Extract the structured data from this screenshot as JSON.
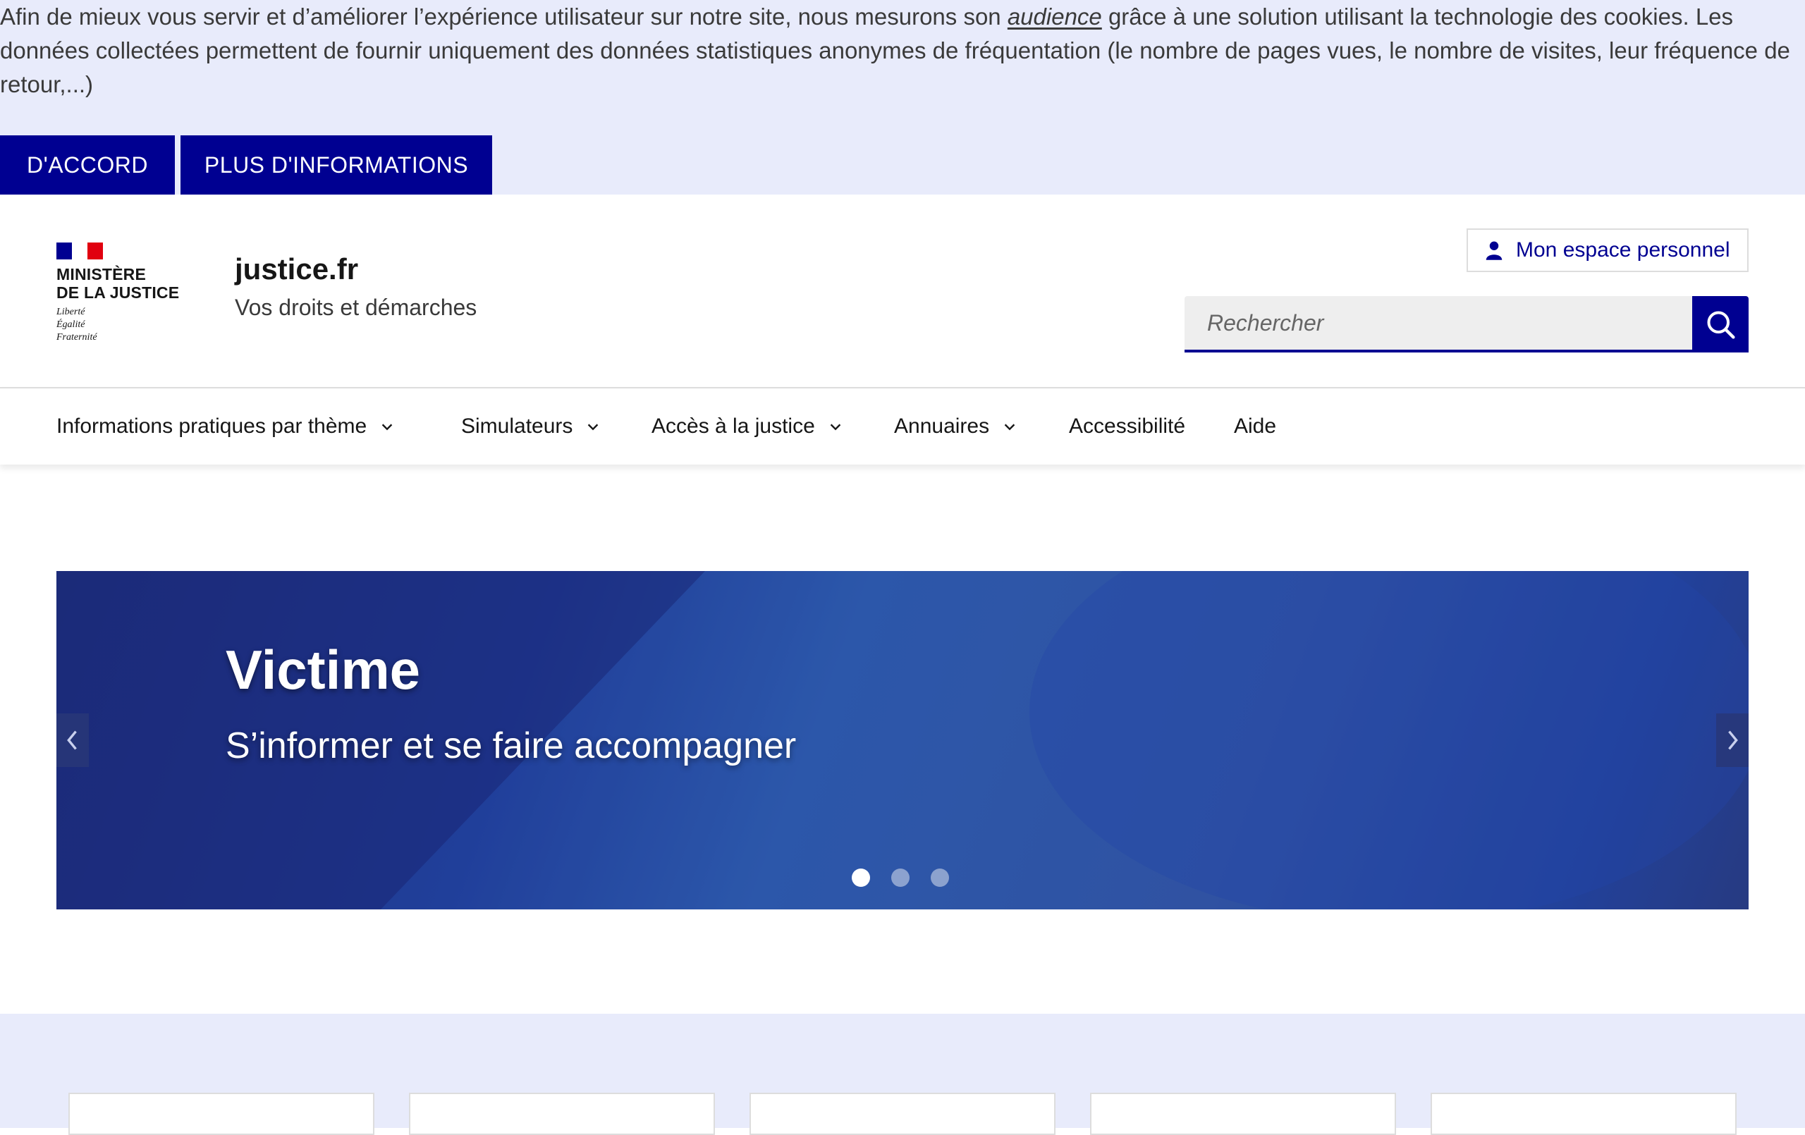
{
  "cookie_banner": {
    "text_before": "Afin de mieux vous servir et d’améliorer l’expérience utilisateur sur notre site, nous mesurons son ",
    "link_text": "audience",
    "text_after": " grâce à une solution utilisant la technologie des cookies. Les données collectées permettent de fournir uniquement des données statistiques anonymes de fréquentation (le nombre de pages vues, le nombre de visites, leur fréquence de retour,...)",
    "accept_label": "D'ACCORD",
    "more_label": "PLUS D'INFORMATIONS"
  },
  "header": {
    "ministry_line1": "Ministère",
    "ministry_line2": "de la Justice",
    "motto_line1": "Liberté",
    "motto_line2": "Égalité",
    "motto_line3": "Fraternité",
    "site_name": "justice.fr",
    "tagline": "Vos droits et démarches",
    "account_label": "Mon espace personnel",
    "search_placeholder": "Rechercher"
  },
  "nav": {
    "items": [
      {
        "label": "Informations pratiques par thème",
        "has_dropdown": true
      },
      {
        "label": "Simulateurs",
        "has_dropdown": true
      },
      {
        "label": "Accès à la justice",
        "has_dropdown": true
      },
      {
        "label": "Annuaires",
        "has_dropdown": true
      },
      {
        "label": "Accessibilité",
        "has_dropdown": false
      },
      {
        "label": "Aide",
        "has_dropdown": false
      }
    ]
  },
  "hero": {
    "title": "Victime",
    "subtitle": "S’informer et se faire accompagner",
    "slide_count": 3,
    "active_slide": 1
  },
  "colors": {
    "primary": "#000091",
    "banner_bg": "#e8ebfb",
    "flag_red": "#e1000f",
    "hero_blue": "#1c3794"
  }
}
